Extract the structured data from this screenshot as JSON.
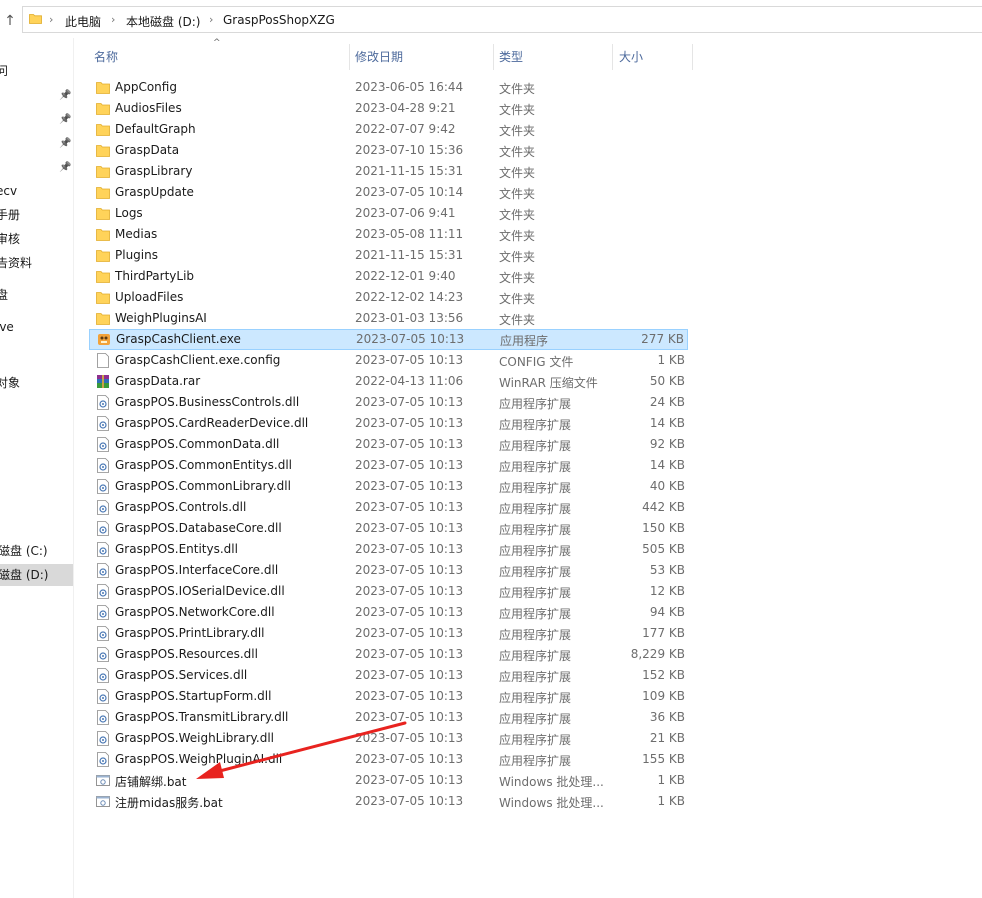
{
  "address": {
    "crumbs": [
      "此电脑",
      "本地磁盘 (D:)",
      "GraspPosShopXZG"
    ]
  },
  "nav": {
    "items": [
      "问",
      "ecv",
      "手册",
      "审核",
      "告资料",
      "盘",
      "ive",
      "对象",
      "磁盘 (C:)",
      "磁盘 (D:)"
    ],
    "selected_index": 9
  },
  "columns": {
    "name": "名称",
    "date": "修改日期",
    "type": "类型",
    "size": "大小"
  },
  "files": [
    {
      "name": "AppConfig",
      "date": "2023-06-05 16:44",
      "type": "文件夹",
      "size": "",
      "icon": "folder-icon"
    },
    {
      "name": "AudiosFiles",
      "date": "2023-04-28 9:21",
      "type": "文件夹",
      "size": "",
      "icon": "folder-icon"
    },
    {
      "name": "DefaultGraph",
      "date": "2022-07-07 9:42",
      "type": "文件夹",
      "size": "",
      "icon": "folder-icon"
    },
    {
      "name": "GraspData",
      "date": "2023-07-10 15:36",
      "type": "文件夹",
      "size": "",
      "icon": "folder-icon"
    },
    {
      "name": "GraspLibrary",
      "date": "2021-11-15 15:31",
      "type": "文件夹",
      "size": "",
      "icon": "folder-icon"
    },
    {
      "name": "GraspUpdate",
      "date": "2023-07-05 10:14",
      "type": "文件夹",
      "size": "",
      "icon": "folder-icon"
    },
    {
      "name": "Logs",
      "date": "2023-07-06 9:41",
      "type": "文件夹",
      "size": "",
      "icon": "folder-icon"
    },
    {
      "name": "Medias",
      "date": "2023-05-08 11:11",
      "type": "文件夹",
      "size": "",
      "icon": "folder-icon"
    },
    {
      "name": "Plugins",
      "date": "2021-11-15 15:31",
      "type": "文件夹",
      "size": "",
      "icon": "folder-icon"
    },
    {
      "name": "ThirdPartyLib",
      "date": "2022-12-01 9:40",
      "type": "文件夹",
      "size": "",
      "icon": "folder-icon"
    },
    {
      "name": "UploadFiles",
      "date": "2022-12-02 14:23",
      "type": "文件夹",
      "size": "",
      "icon": "folder-icon"
    },
    {
      "name": "WeighPluginsAI",
      "date": "2023-01-03 13:56",
      "type": "文件夹",
      "size": "",
      "icon": "folder-icon"
    },
    {
      "name": "GraspCashClient.exe",
      "date": "2023-07-05 10:13",
      "type": "应用程序",
      "size": "277 KB",
      "icon": "app-icon",
      "selected": true
    },
    {
      "name": "GraspCashClient.exe.config",
      "date": "2023-07-05 10:13",
      "type": "CONFIG 文件",
      "size": "1 KB",
      "icon": "blank-file-icon"
    },
    {
      "name": "GraspData.rar",
      "date": "2022-04-13 11:06",
      "type": "WinRAR 压缩文件",
      "size": "50 KB",
      "icon": "winrar-icon"
    },
    {
      "name": "GraspPOS.BusinessControls.dll",
      "date": "2023-07-05 10:13",
      "type": "应用程序扩展",
      "size": "24 KB",
      "icon": "dll-icon"
    },
    {
      "name": "GraspPOS.CardReaderDevice.dll",
      "date": "2023-07-05 10:13",
      "type": "应用程序扩展",
      "size": "14 KB",
      "icon": "dll-icon"
    },
    {
      "name": "GraspPOS.CommonData.dll",
      "date": "2023-07-05 10:13",
      "type": "应用程序扩展",
      "size": "92 KB",
      "icon": "dll-icon"
    },
    {
      "name": "GraspPOS.CommonEntitys.dll",
      "date": "2023-07-05 10:13",
      "type": "应用程序扩展",
      "size": "14 KB",
      "icon": "dll-icon"
    },
    {
      "name": "GraspPOS.CommonLibrary.dll",
      "date": "2023-07-05 10:13",
      "type": "应用程序扩展",
      "size": "40 KB",
      "icon": "dll-icon"
    },
    {
      "name": "GraspPOS.Controls.dll",
      "date": "2023-07-05 10:13",
      "type": "应用程序扩展",
      "size": "442 KB",
      "icon": "dll-icon"
    },
    {
      "name": "GraspPOS.DatabaseCore.dll",
      "date": "2023-07-05 10:13",
      "type": "应用程序扩展",
      "size": "150 KB",
      "icon": "dll-icon"
    },
    {
      "name": "GraspPOS.Entitys.dll",
      "date": "2023-07-05 10:13",
      "type": "应用程序扩展",
      "size": "505 KB",
      "icon": "dll-icon"
    },
    {
      "name": "GraspPOS.InterfaceCore.dll",
      "date": "2023-07-05 10:13",
      "type": "应用程序扩展",
      "size": "53 KB",
      "icon": "dll-icon"
    },
    {
      "name": "GraspPOS.IOSerialDevice.dll",
      "date": "2023-07-05 10:13",
      "type": "应用程序扩展",
      "size": "12 KB",
      "icon": "dll-icon"
    },
    {
      "name": "GraspPOS.NetworkCore.dll",
      "date": "2023-07-05 10:13",
      "type": "应用程序扩展",
      "size": "94 KB",
      "icon": "dll-icon"
    },
    {
      "name": "GraspPOS.PrintLibrary.dll",
      "date": "2023-07-05 10:13",
      "type": "应用程序扩展",
      "size": "177 KB",
      "icon": "dll-icon"
    },
    {
      "name": "GraspPOS.Resources.dll",
      "date": "2023-07-05 10:13",
      "type": "应用程序扩展",
      "size": "8,229 KB",
      "icon": "dll-icon"
    },
    {
      "name": "GraspPOS.Services.dll",
      "date": "2023-07-05 10:13",
      "type": "应用程序扩展",
      "size": "152 KB",
      "icon": "dll-icon"
    },
    {
      "name": "GraspPOS.StartupForm.dll",
      "date": "2023-07-05 10:13",
      "type": "应用程序扩展",
      "size": "109 KB",
      "icon": "dll-icon"
    },
    {
      "name": "GraspPOS.TransmitLibrary.dll",
      "date": "2023-07-05 10:13",
      "type": "应用程序扩展",
      "size": "36 KB",
      "icon": "dll-icon"
    },
    {
      "name": "GraspPOS.WeighLibrary.dll",
      "date": "2023-07-05 10:13",
      "type": "应用程序扩展",
      "size": "21 KB",
      "icon": "dll-icon"
    },
    {
      "name": "GraspPOS.WeighPluginAI.dll",
      "date": "2023-07-05 10:13",
      "type": "应用程序扩展",
      "size": "155 KB",
      "icon": "dll-icon"
    },
    {
      "name": "店铺解绑.bat",
      "date": "2023-07-05 10:13",
      "type": "Windows 批处理...",
      "size": "1 KB",
      "icon": "bat-icon"
    },
    {
      "name": "注册midas服务.bat",
      "date": "2023-07-05 10:13",
      "type": "Windows 批处理...",
      "size": "1 KB",
      "icon": "bat-icon"
    }
  ],
  "annotation": {
    "color": "#e8231f"
  }
}
